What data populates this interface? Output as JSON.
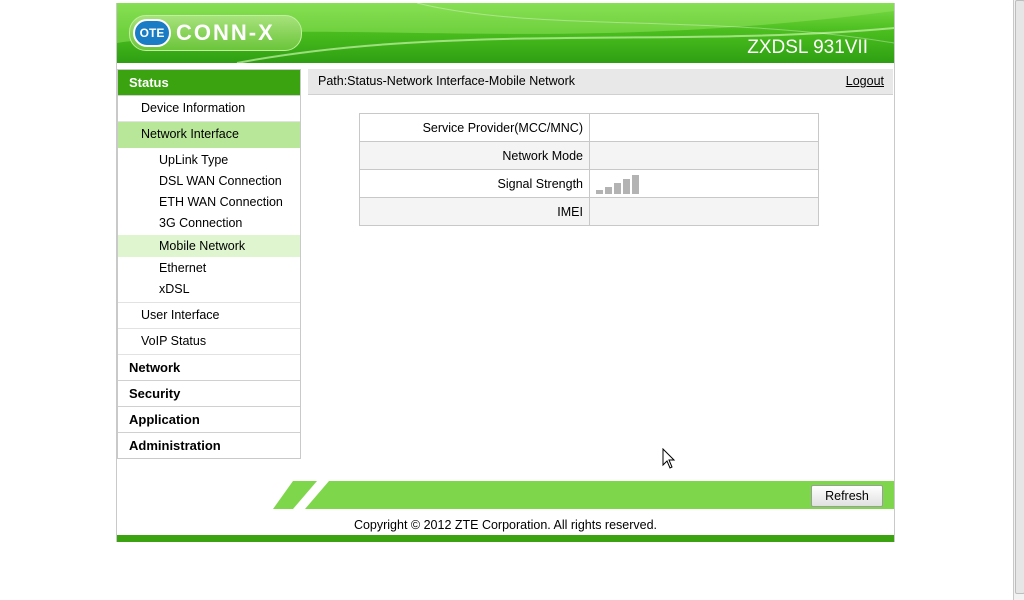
{
  "header": {
    "logo_badge": "OTE",
    "logo_brand": "CONN-X",
    "model": "ZXDSL 931VII"
  },
  "sidebar": {
    "status": "Status",
    "device_information": "Device Information",
    "network_interface": "Network Interface",
    "network_interface_items": [
      "UpLink Type",
      "DSL WAN Connection",
      "ETH WAN Connection",
      "3G Connection",
      "Mobile Network",
      "Ethernet",
      "xDSL"
    ],
    "user_interface": "User Interface",
    "voip_status": "VoIP Status",
    "network": "Network",
    "security": "Security",
    "application": "Application",
    "administration": "Administration"
  },
  "path": {
    "text": "Path:Status-Network Interface-Mobile Network",
    "logout": "Logout"
  },
  "table": {
    "rows": [
      {
        "label": "Service Provider(MCC/MNC)",
        "value": ""
      },
      {
        "label": "Network Mode",
        "value": ""
      },
      {
        "label": "Signal Strength",
        "value": ""
      },
      {
        "label": "IMEI",
        "value": ""
      }
    ],
    "signal_bars_active": 0,
    "signal_bars_total": 5
  },
  "footer": {
    "refresh": "Refresh",
    "copyright": "Copyright © 2012 ZTE Corporation. All rights reserved."
  },
  "colors": {
    "accent": "#3aa30f",
    "sub_active": "#b9e79a",
    "item_active": "#dff5cf"
  }
}
